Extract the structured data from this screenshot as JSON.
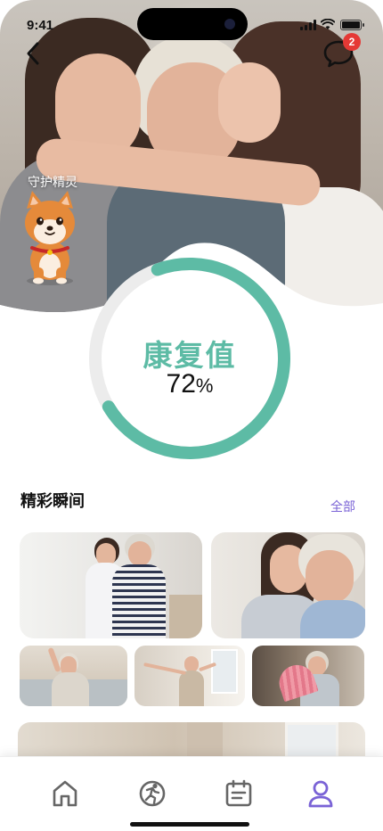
{
  "status_bar": {
    "time": "9:41"
  },
  "header": {
    "notification_count": "2"
  },
  "guardian": {
    "label": "守护精灵"
  },
  "recovery": {
    "title": "康复值",
    "value": "72",
    "unit": "%",
    "progress": 0.72,
    "color": "#5dbba5",
    "track_color": "#ececec"
  },
  "highlights": {
    "title": "精彩瞬间",
    "view_all": "全部"
  },
  "tabbar": {
    "items": [
      {
        "icon": "home-icon",
        "active": false
      },
      {
        "icon": "sport-icon",
        "active": false
      },
      {
        "icon": "calendar-icon",
        "active": false
      },
      {
        "icon": "profile-icon",
        "active": true
      }
    ],
    "active_color": "#7a63d6",
    "inactive_color": "#666666"
  }
}
